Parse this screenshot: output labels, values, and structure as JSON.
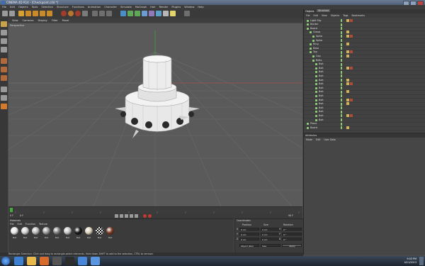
{
  "window": {
    "title": "CINEMA 4D R14 - [Checkpoint.c4d *]"
  },
  "menu": {
    "items": [
      "File",
      "Edit",
      "Objects",
      "Tools",
      "Selection",
      "Structure",
      "Functions",
      "Animation",
      "Character",
      "Simulate",
      "MoGraph",
      "Hair",
      "Render",
      "Plugins",
      "Window",
      "Help"
    ]
  },
  "viewport": {
    "menu": [
      "View",
      "Cameras",
      "Display",
      "Filter",
      "Panel"
    ],
    "label": "Perspective"
  },
  "objects_panel": {
    "tabs": [
      "Objects",
      "Structure"
    ],
    "menu": [
      "File",
      "Edit",
      "View",
      "Objects",
      "Tags",
      "Bookmarks"
    ],
    "items": [
      {
        "name": "Light Sky",
        "level": 0
      },
      {
        "name": "Border",
        "level": 0
      },
      {
        "name": "Board",
        "level": 0
      },
      {
        "name": "Group",
        "level": 1
      },
      {
        "name": "Spike",
        "level": 2
      },
      {
        "name": "Spike",
        "level": 2
      },
      {
        "name": "Ring",
        "level": 1
      },
      {
        "name": "Base",
        "level": 1
      },
      {
        "name": "Top",
        "level": 1
      },
      {
        "name": "Cap",
        "level": 2
      },
      {
        "name": "Bolts",
        "level": 2
      },
      {
        "name": "Bolt",
        "level": 3
      },
      {
        "name": "Bolt",
        "level": 3
      },
      {
        "name": "Bolt",
        "level": 3
      },
      {
        "name": "Bolt",
        "level": 3
      },
      {
        "name": "Bolt",
        "level": 3
      },
      {
        "name": "Bolt",
        "level": 3
      },
      {
        "name": "Bolt",
        "level": 3
      },
      {
        "name": "Bolt",
        "level": 3
      },
      {
        "name": "Bolt",
        "level": 3
      },
      {
        "name": "Bolt",
        "level": 3
      },
      {
        "name": "Bolt",
        "level": 3
      },
      {
        "name": "Bolt",
        "level": 3
      },
      {
        "name": "Bolt",
        "level": 3
      },
      {
        "name": "Bolt",
        "level": 3
      },
      {
        "name": "Bolt",
        "level": 3
      },
      {
        "name": "Plane",
        "level": 0
      },
      {
        "name": "Board",
        "level": 0
      }
    ]
  },
  "attributes_panel": {
    "tab": "Attributes",
    "menu": [
      "Mode",
      "Edit",
      "User Data"
    ]
  },
  "materials_panel": {
    "tab": "Materials",
    "menu": [
      "File",
      "Edit",
      "Function",
      "Texture"
    ],
    "materials": [
      {
        "name": "Mat",
        "color": "#e6e6e6"
      },
      {
        "name": "Mat",
        "color": "#d0d0d0"
      },
      {
        "name": "Mat",
        "color": "#b8b8b8"
      },
      {
        "name": "Mat",
        "color": "#9a9a9a"
      },
      {
        "name": "Mat",
        "color": "#7d7d7d"
      },
      {
        "name": "Mat",
        "color": "#c4c4c4"
      },
      {
        "name": "Mat",
        "color": "#161616"
      },
      {
        "name": "Mat",
        "color": "#d9cfb8"
      },
      {
        "name": "Mat",
        "color": "checker"
      },
      {
        "name": "Mat",
        "color": "#7a3a22"
      }
    ]
  },
  "coordinates_panel": {
    "tab": "Coordinates",
    "headers": [
      "Position",
      "Size",
      "Rotation"
    ],
    "rows": [
      {
        "axis": "X",
        "pos": "0 cm",
        "size": "0 cm",
        "rot": "H",
        "rotval": "0 °"
      },
      {
        "axis": "Y",
        "pos": "0 cm",
        "size": "0 cm",
        "rot": "P",
        "rotval": "0 °"
      },
      {
        "axis": "Z",
        "pos": "0 cm",
        "size": "0 cm",
        "rot": "B",
        "rotval": "0 °"
      }
    ],
    "mode": "Object (Rel)",
    "size_mode": "Size",
    "apply": "Apply"
  },
  "timeline": {
    "start": "0 F",
    "end": "90 F",
    "current": "0 F"
  },
  "status": "Rectangle Selection: Click and drag to rectangle-select elements. Hold down SHIFT to add to the selection, CTRL to remove.",
  "taskbar": {
    "time": "9:03 PM",
    "date": "4/11/2013"
  },
  "colors": {
    "accent": "#3e6fb3",
    "viewport_bg": "#5a5a5a",
    "panel_bg": "#424242"
  }
}
